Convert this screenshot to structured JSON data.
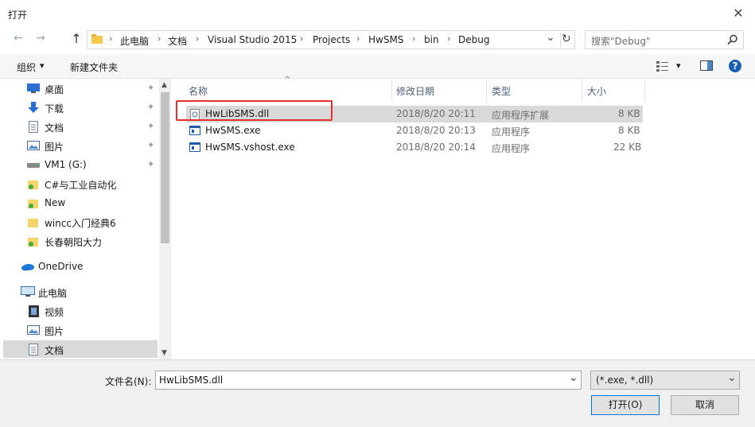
{
  "window": {
    "title": "打开",
    "close_glyph": "✕"
  },
  "navigation": {
    "back_glyph": "←",
    "forward_glyph": "→",
    "up_glyph": "↑",
    "dropdown_glyph": "⌄",
    "refresh_glyph": "↻",
    "breadcrumbs": [
      "此电脑",
      "文档",
      "Visual Studio 2015",
      "Projects",
      "HwSMS",
      "bin",
      "Debug"
    ],
    "separator": "›",
    "search_placeholder": "搜索\"Debug\""
  },
  "toolbar": {
    "organize": "组织",
    "organize_arrow": "▾",
    "new_folder": "新建文件夹",
    "view_arrow": "▾",
    "help_glyph": "?"
  },
  "sidebar": {
    "items": [
      {
        "label": "桌面",
        "icon": "desktop-icon",
        "pinned": true
      },
      {
        "label": "下载",
        "icon": "download-icon",
        "pinned": true
      },
      {
        "label": "文档",
        "icon": "document-icon",
        "pinned": true
      },
      {
        "label": "图片",
        "icon": "picture-icon",
        "pinned": true
      },
      {
        "label": "VM1 (G:)",
        "icon": "drive-icon",
        "pinned": true
      },
      {
        "label": "C#与工业自动化",
        "icon": "folder-icon",
        "pinned": false
      },
      {
        "label": "New",
        "icon": "folder-icon",
        "pinned": false
      },
      {
        "label": "wincc入门经典6",
        "icon": "folder-icon",
        "pinned": false
      },
      {
        "label": "长春朝阳大力",
        "icon": "folder-icon",
        "pinned": false
      },
      {
        "label": "OneDrive",
        "icon": "cloud-icon",
        "pinned": false
      },
      {
        "label": "此电脑",
        "icon": "computer-icon",
        "pinned": false
      },
      {
        "label": "视频",
        "icon": "video-icon",
        "pinned": false
      },
      {
        "label": "图片",
        "icon": "picture-icon",
        "pinned": false
      },
      {
        "label": "文档",
        "icon": "document-icon",
        "pinned": false
      }
    ],
    "pin_glyph": "📌"
  },
  "file_list": {
    "columns": {
      "name": "名称",
      "date": "修改日期",
      "type": "类型",
      "size": "大小"
    },
    "sort_glyph": "^",
    "rows": [
      {
        "name": "HwLibSMS.dll",
        "date": "2018/8/20 20:11",
        "type": "应用程序扩展",
        "size": "8 KB",
        "selected": true
      },
      {
        "name": "HwSMS.exe",
        "date": "2018/8/20 20:13",
        "type": "应用程序",
        "size": "8 KB",
        "selected": false
      },
      {
        "name": "HwSMS.vshost.exe",
        "date": "2018/8/20 20:14",
        "type": "应用程序",
        "size": "22 KB",
        "selected": false
      }
    ]
  },
  "footer": {
    "filename_label": "文件名(N):",
    "filename_value": "HwLibSMS.dll",
    "filetype_value": "(*.exe, *.dll)",
    "dropdown_glyph": "⌄",
    "open_button": "打开(O)",
    "cancel_button": "取消"
  },
  "colors": {
    "highlight": "#e0312c",
    "selection": "#d9d9d9",
    "accent": "#0078d7"
  }
}
